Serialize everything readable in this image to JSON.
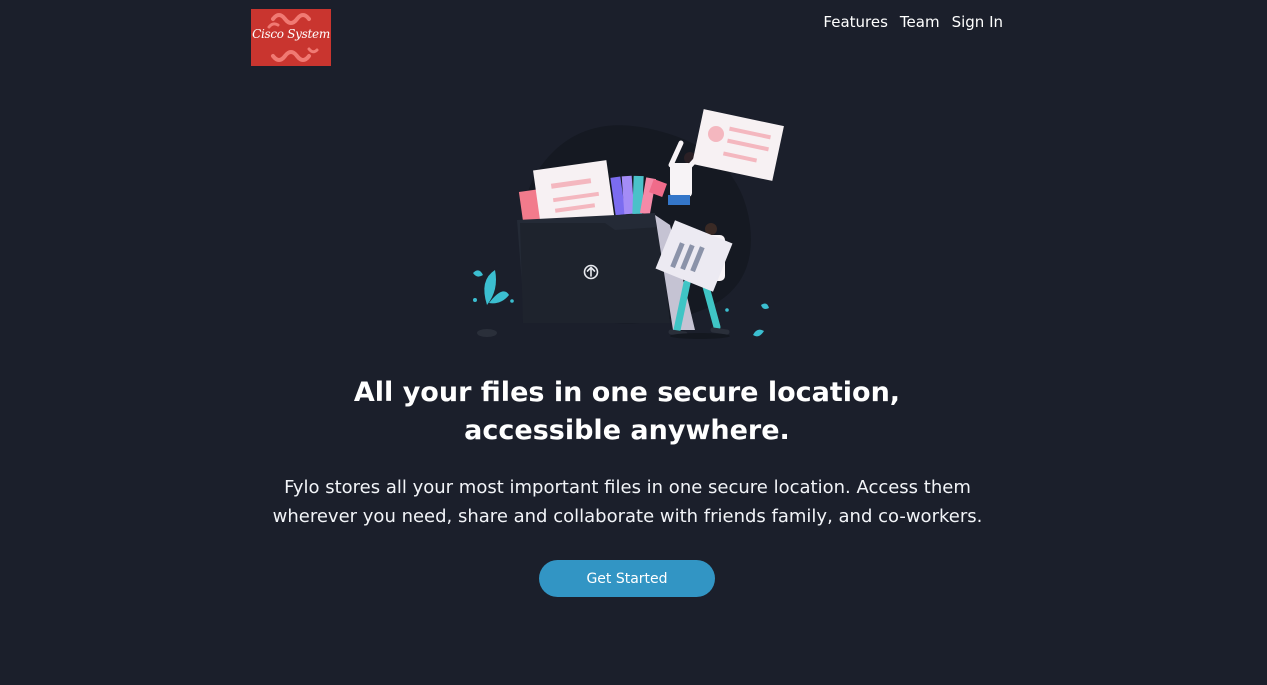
{
  "brand": {
    "logo_text": "Cisco System",
    "logo_color": "#c9352f"
  },
  "nav": {
    "items": [
      {
        "label": "Features"
      },
      {
        "label": "Team"
      },
      {
        "label": "Sign In"
      }
    ]
  },
  "hero": {
    "illustration": "files-folder-illustration",
    "headline": "All your files in one secure location, accessible anywhere.",
    "subtext": "Fylo stores all your most important files in one secure location. Access them wherever you need, share and collaborate with friends family, and co-workers.",
    "cta_label": "Get Started"
  },
  "colors": {
    "background": "#1b1f2b",
    "accent": "#3295c4",
    "text": "#ffffff"
  }
}
